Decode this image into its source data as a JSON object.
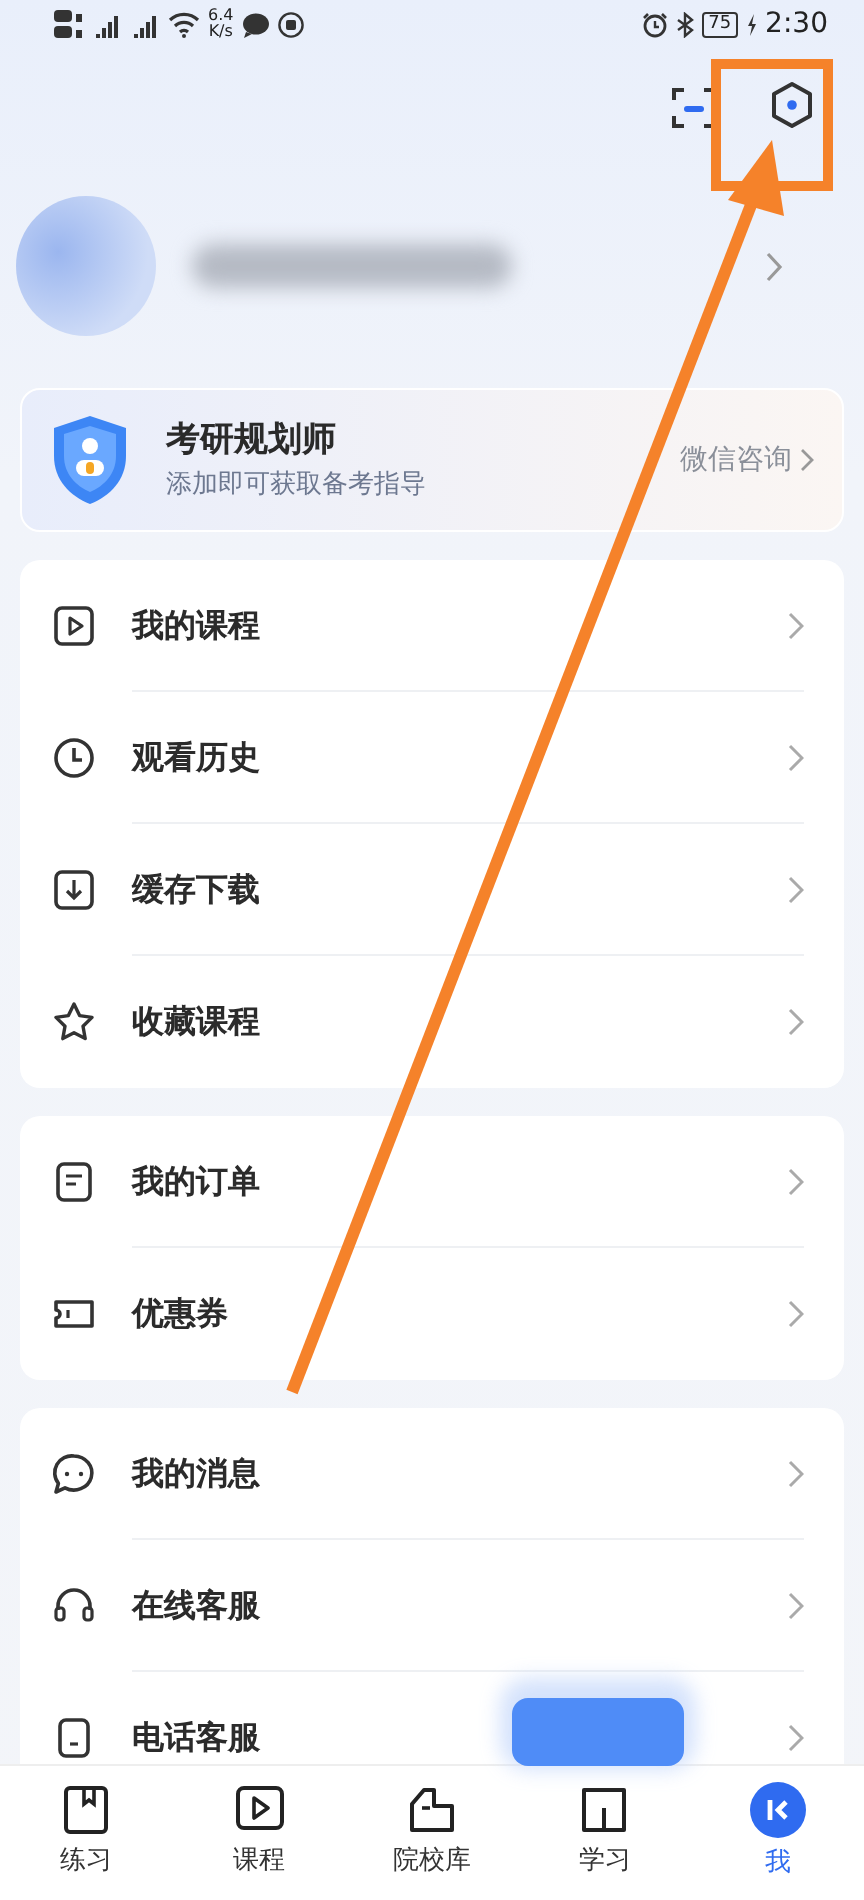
{
  "status_bar": {
    "net_speed": "6.4",
    "net_unit": "K/s",
    "battery": "75",
    "time": "2:30"
  },
  "planner": {
    "title": "考研规划师",
    "subtitle": "添加即可获取备考指导",
    "action": "微信咨询"
  },
  "menu_groups": [
    [
      {
        "label": "我的课程"
      },
      {
        "label": "观看历史"
      },
      {
        "label": "缓存下载"
      },
      {
        "label": "收藏课程"
      }
    ],
    [
      {
        "label": "我的订单"
      },
      {
        "label": "优惠券"
      }
    ],
    [
      {
        "label": "我的消息"
      },
      {
        "label": "在线客服"
      },
      {
        "label": "电话客服"
      }
    ]
  ],
  "tabs": [
    {
      "label": "练习",
      "selected": false
    },
    {
      "label": "课程",
      "selected": false
    },
    {
      "label": "院校库",
      "selected": false
    },
    {
      "label": "学习",
      "selected": false
    },
    {
      "label": "我",
      "selected": true
    }
  ]
}
